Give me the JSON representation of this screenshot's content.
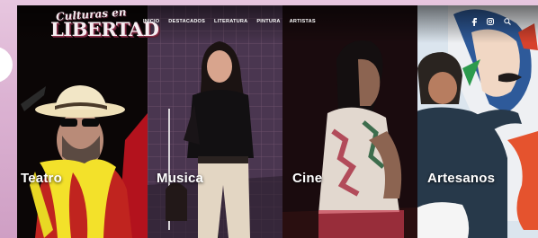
{
  "site": {
    "logo": {
      "line1": "Culturas en",
      "line2": "LIBERTAD"
    },
    "nav": [
      "INICIO",
      "DESTACADOS",
      "LITERATURA",
      "PINTURA",
      "ARTISTAS"
    ],
    "social": [
      "facebook-icon",
      "instagram-icon",
      "search-icon"
    ]
  },
  "panels": [
    {
      "id": "teatro",
      "title": "Teatro"
    },
    {
      "id": "musica",
      "title": "Musica"
    },
    {
      "id": "cine",
      "title": "Cine"
    },
    {
      "id": "artesanos",
      "title": "Artesanos"
    }
  ]
}
